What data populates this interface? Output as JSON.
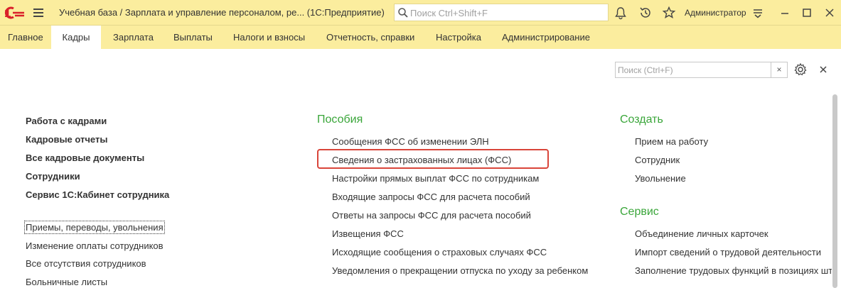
{
  "titlebar": {
    "title": "Учебная база / Зарплата и управление персоналом, ре...  (1С:Предприятие)",
    "search_placeholder": "Поиск Ctrl+Shift+F",
    "user": "Администратор"
  },
  "menu": {
    "items": [
      {
        "label": "Главное"
      },
      {
        "label": "Кадры"
      },
      {
        "label": "Зарплата"
      },
      {
        "label": "Выплаты"
      },
      {
        "label": "Налоги и взносы"
      },
      {
        "label": "Отчетность, справки"
      },
      {
        "label": "Настройка"
      },
      {
        "label": "Администрирование"
      }
    ],
    "active": "Кадры"
  },
  "panel": {
    "search_placeholder": "Поиск (Ctrl+F)",
    "clear_label": "×"
  },
  "left": {
    "bold_links": [
      "Работа с кадрами",
      "Кадровые отчеты",
      "Все кадровые документы",
      "Сотрудники",
      "Сервис 1С:Кабинет сотрудника"
    ],
    "links": [
      "Приемы, переводы, увольнения",
      "Изменение оплаты сотрудников",
      "Все отсутствия сотрудников",
      "Больничные листы"
    ]
  },
  "posobiya": {
    "title": "Пособия",
    "links": [
      "Сообщения ФСС об изменении ЭЛН",
      "Сведения о застрахованных лицах (ФСС)",
      "Настройки прямых выплат ФСС по сотрудникам",
      "Входящие запросы ФСС для расчета пособий",
      "Ответы на запросы ФСС для расчета пособий",
      "Извещения ФСС",
      "Исходящие сообщения о страховых случаях ФСС",
      "Уведомления о прекращении отпуска по уходу за ребенком"
    ]
  },
  "sozdat": {
    "title": "Создать",
    "links": [
      "Прием на работу",
      "Сотрудник",
      "Увольнение"
    ]
  },
  "servis": {
    "title": "Сервис",
    "links": [
      "Объединение личных карточек",
      "Импорт сведений о трудовой деятельности",
      "Заполнение трудовых функций в позициях шт"
    ]
  },
  "colors": {
    "header_bg": "#fbed9e",
    "section_title": "#3aa63a",
    "highlight": "#d9453a",
    "logo": "#d9202a"
  }
}
